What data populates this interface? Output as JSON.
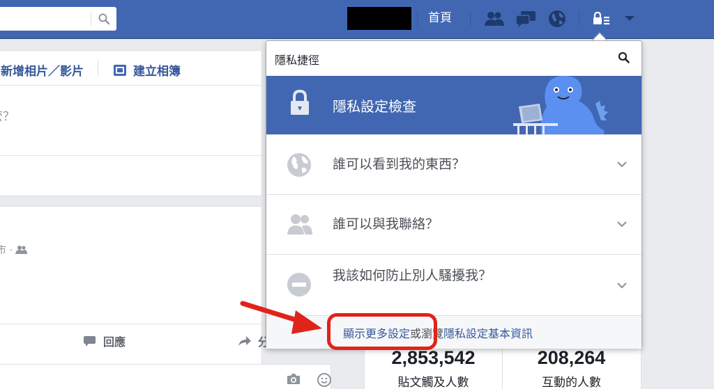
{
  "topbar": {
    "home_label": "首頁"
  },
  "composer": {
    "tab_photo_label": "新增相片／影片",
    "tab_album_label": "建立相簿",
    "prompt_text": "麼？"
  },
  "post": {
    "meta_text": "市 ·",
    "reply_label": "回應",
    "share_label": "分"
  },
  "stats": [
    {
      "value": "2,853,542",
      "label": "貼文觸及人數"
    },
    {
      "value": "208,264",
      "label": "互動的人數"
    }
  ],
  "privacy": {
    "title": "隱私捷徑",
    "banner_label": "隱私設定檢查",
    "items": [
      {
        "label": "誰可以看到我的東西？",
        "icon": "globe-icon"
      },
      {
        "label": "誰可以與我聯絡？",
        "icon": "friends-icon"
      },
      {
        "label": "我該如何防止別人騷擾我？",
        "icon": "block-icon"
      }
    ],
    "footer_more": "顯示更多設定",
    "footer_or": "或",
    "footer_browse": "瀏覽",
    "footer_basics": "隱私設定基本資訊"
  },
  "colors": {
    "brand_blue": "#4267b2",
    "link_blue": "#365899",
    "annotation_red": "#e0231b"
  }
}
